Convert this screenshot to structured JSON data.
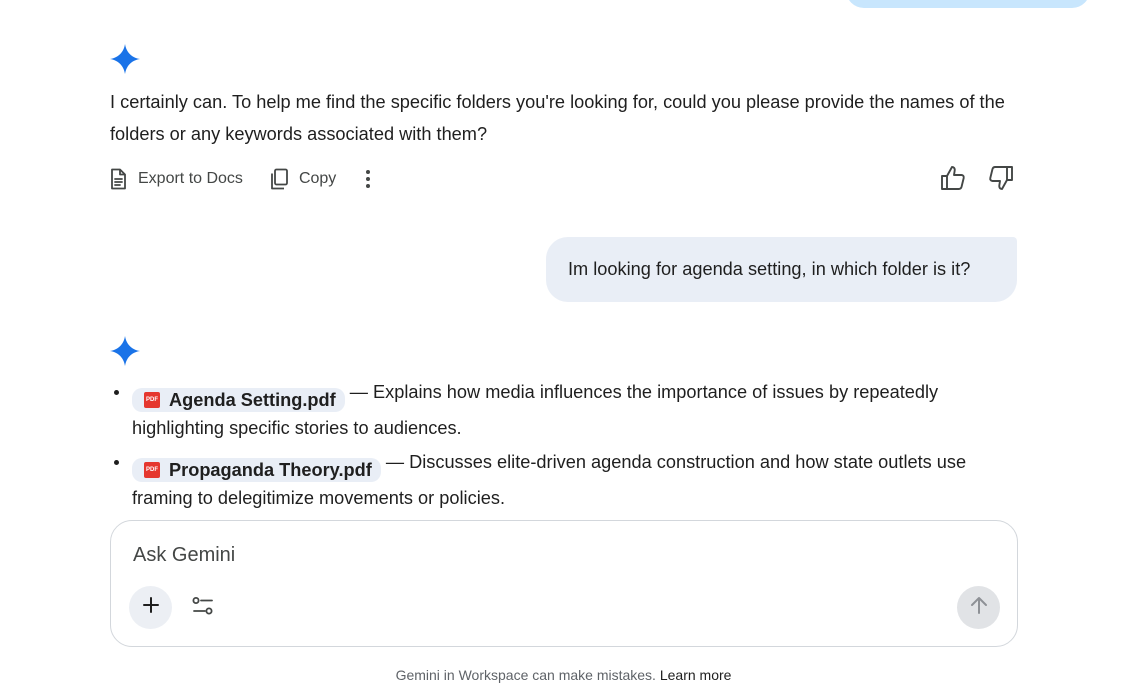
{
  "colors": {
    "spark_blue": "#1a73e8",
    "user_bubble_bg": "#e9eef6",
    "top_bubble_bg": "#c8e6fd",
    "pdf_red": "#e5372e"
  },
  "icons": {
    "spark": "gemini-spark-icon",
    "export": "document-icon",
    "copy": "copy-icon",
    "more": "more-vert-icon",
    "thumbs_up": "thumbs-up-icon",
    "thumbs_down": "thumbs-down-icon",
    "add": "plus-icon",
    "tools": "tune-icon",
    "send": "arrow-up-icon",
    "file": "pdf-icon"
  },
  "response1": {
    "text": "I certainly can. To help me find the specific folders you're looking for, could you please provide the names of the folders or any keywords associated with them?",
    "actions": {
      "export_label": "Export to Docs",
      "copy_label": "Copy"
    }
  },
  "user_message": {
    "text": "Im looking for agenda setting, in which folder is it?"
  },
  "response2": {
    "items": [
      {
        "file_name": "Agenda Setting.pdf",
        "file_badge": "PDF",
        "description": " — Explains how media influences the importance of issues by repeatedly highlighting specific stories to audiences."
      },
      {
        "file_name": "Propaganda Theory.pdf",
        "file_badge": "PDF",
        "description": " — Discusses elite-driven agenda construction and how state outlets use framing to delegitimize movements or policies."
      }
    ]
  },
  "input": {
    "placeholder": "Ask Gemini",
    "value": ""
  },
  "footer": {
    "disclaimer": "Gemini in Workspace can make mistakes.",
    "learn_more": "Learn more"
  }
}
